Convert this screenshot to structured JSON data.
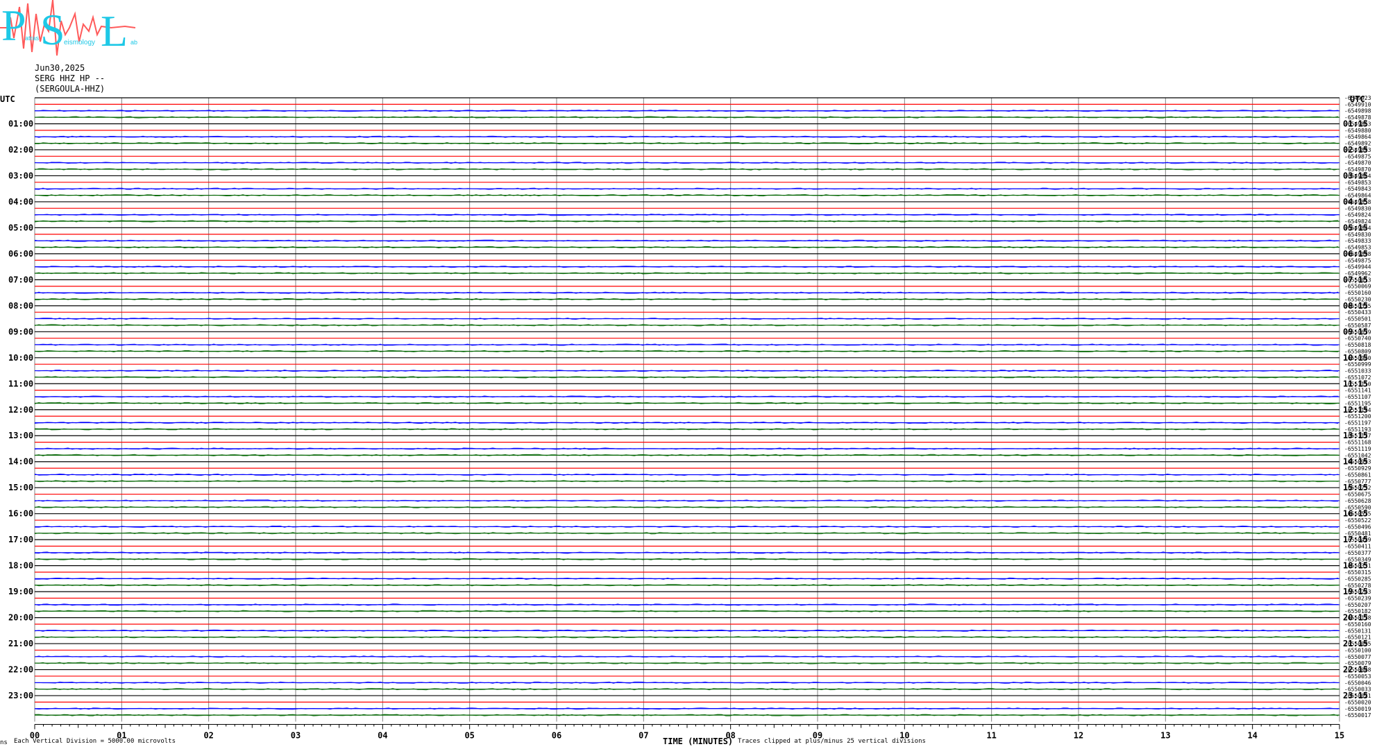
{
  "logo": {
    "big": [
      "P",
      "S",
      "L"
    ],
    "small": [
      "atras",
      "eismology",
      "ab"
    ]
  },
  "header": {
    "date": "Jun30,2025",
    "station": "SERG HHZ HP --",
    "name": "(SERGOULA-HHZ)"
  },
  "chart_data": {
    "type": "line",
    "title": "Jun30,2025 SERG HHZ HP -- (SERGOULA-HHZ)",
    "xlabel": "TIME (MINUTES)",
    "xlim": [
      0,
      15
    ],
    "x_ticks": [
      "00",
      "01",
      "02",
      "03",
      "04",
      "05",
      "06",
      "07",
      "08",
      "09",
      "10",
      "11",
      "12",
      "13",
      "14",
      "15"
    ],
    "left_axis_title": "UTC",
    "right_axis_title": "UTC",
    "left_hour_labels": [
      "01:00",
      "02:00",
      "03:00",
      "04:00",
      "05:00",
      "06:00",
      "07:00",
      "08:00",
      "09:00",
      "10:00",
      "11:00",
      "12:00",
      "13:00",
      "14:00",
      "15:00",
      "16:00",
      "17:00",
      "18:00",
      "19:00",
      "20:00",
      "21:00",
      "22:00",
      "23:00"
    ],
    "right_hour_labels": [
      "01:15",
      "02:15",
      "03:15",
      "04:15",
      "05:15",
      "06:15",
      "07:15",
      "08:15",
      "09:15",
      "10:15",
      "11:15",
      "12:15",
      "13:15",
      "14:15",
      "15:15",
      "16:15",
      "17:15",
      "18:15",
      "19:15",
      "20:15",
      "21:15",
      "22:15",
      "23:15"
    ],
    "rows_per_hour": 4,
    "trace_colors": [
      "#000000",
      "#ff0000",
      "#0000ff",
      "#006400"
    ],
    "offsets": [
      "6549923",
      "6549910",
      "6549898",
      "6549878",
      "6549863",
      "6549880",
      "6549864",
      "6549892",
      "6549893",
      "6549875",
      "6549870",
      "6549870",
      "6549864",
      "6549853",
      "6549843",
      "6549864",
      "6549858",
      "6549830",
      "6549824",
      "6549824",
      "6549844",
      "6549830",
      "6549833",
      "6549853",
      "6549898",
      "6549875",
      "6549944",
      "6549962",
      "6550013",
      "6550069",
      "6550160",
      "6550230",
      "6550325",
      "6550433",
      "6550501",
      "6550587",
      "6550679",
      "6550740",
      "6550818",
      "6550809",
      "6550940",
      "6550999",
      "6551033",
      "6551072",
      "6551110",
      "6551141",
      "6551107",
      "6551195",
      "6551194",
      "6551200",
      "6551197",
      "6551193",
      "6551177",
      "6551168",
      "6551119",
      "6551042",
      "6550993",
      "6550929",
      "6550861",
      "6550777",
      "6550732",
      "6550675",
      "6550628",
      "6550590",
      "6550575",
      "6550522",
      "6550496",
      "6550481",
      "6550429",
      "6550411",
      "6550377",
      "6550349",
      "6550331",
      "6550315",
      "6550285",
      "6550278",
      "6550243",
      "6550239",
      "6550207",
      "6550182",
      "6550178",
      "6550160",
      "6550131",
      "6550121",
      "6550095",
      "6550100",
      "6550077",
      "6550079",
      "6550048",
      "6550053",
      "6550046",
      "6550033",
      "6550021",
      "6550020",
      "6550019",
      "6550017"
    ],
    "footer_left": "Each Vertical Division = 5000.00 microvolts",
    "footer_right": "Traces clipped at plus/minus 25 vertical divisions",
    "footer_mark": "ns"
  }
}
